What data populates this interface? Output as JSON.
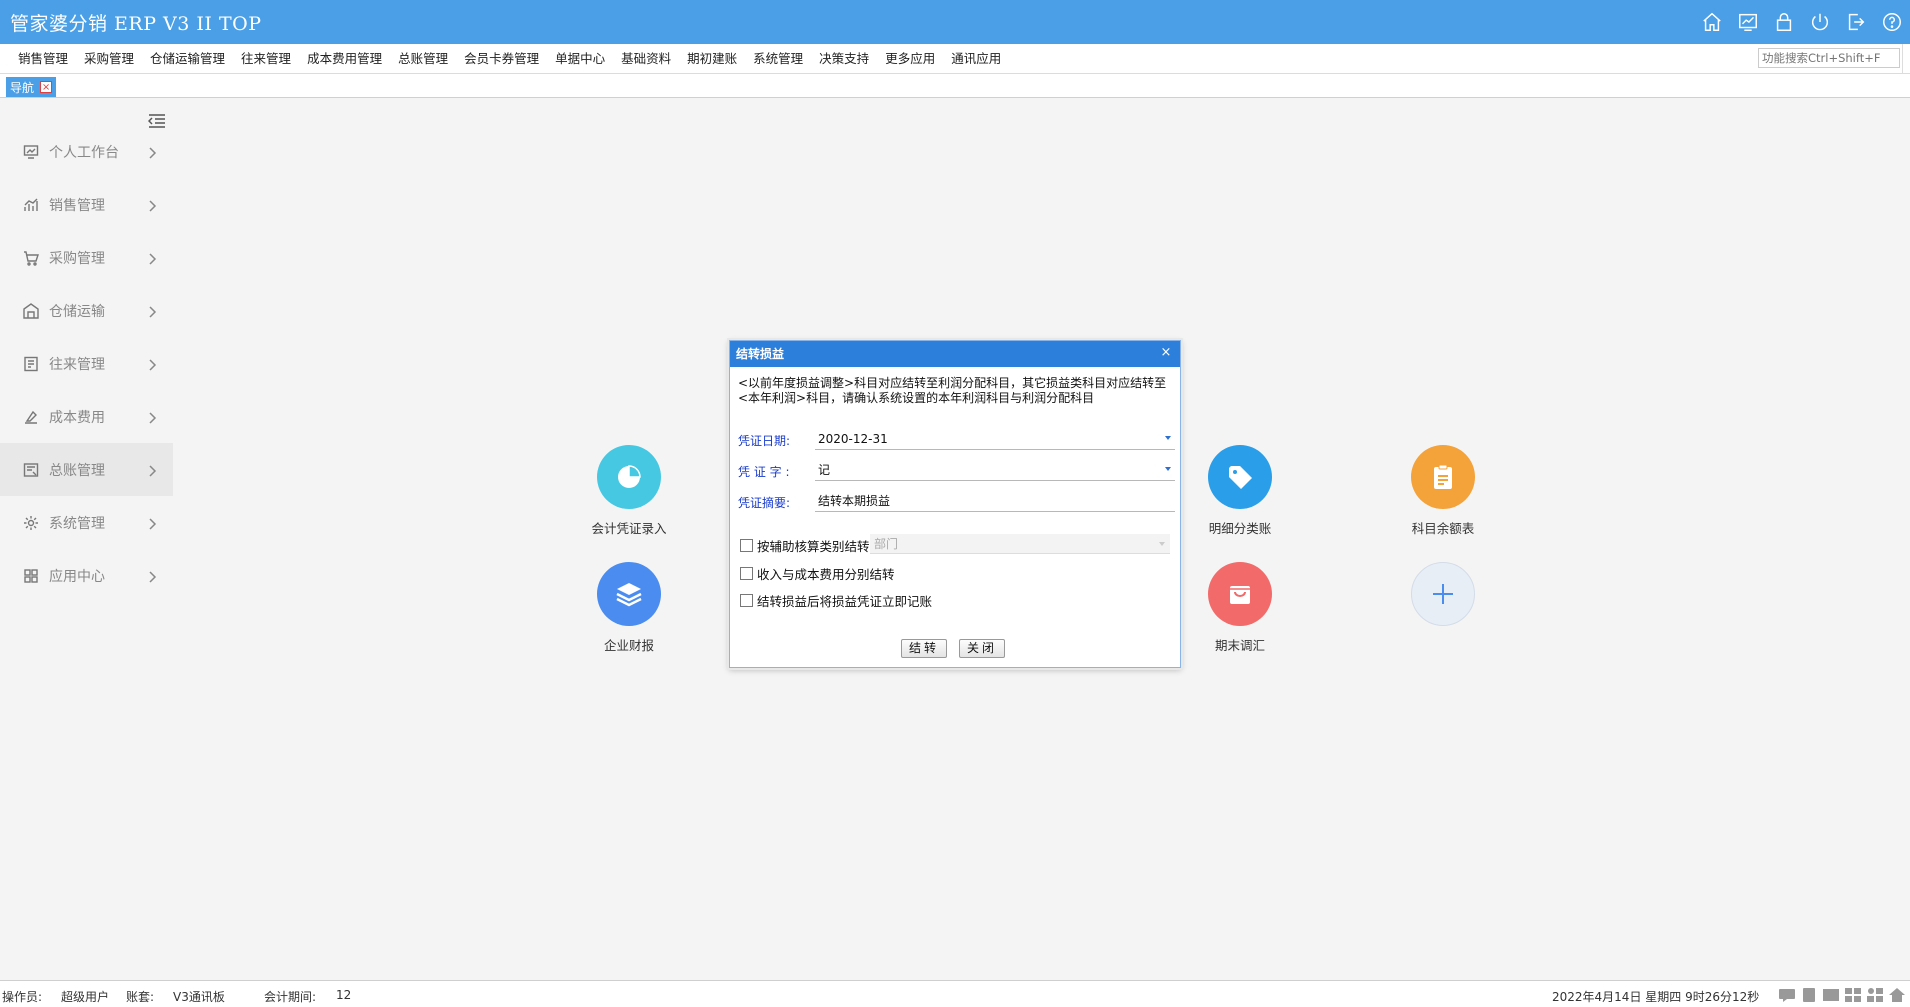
{
  "app": {
    "title": "管家婆分销 ERP V3 II TOP"
  },
  "menu": {
    "items": [
      "销售管理",
      "采购管理",
      "仓储运输管理",
      "往来管理",
      "成本费用管理",
      "总账管理",
      "会员卡券管理",
      "单据中心",
      "基础资料",
      "期初建账",
      "系统管理",
      "决策支持",
      "更多应用",
      "通讯应用"
    ],
    "search_placeholder": "功能搜索Ctrl+Shift+F"
  },
  "tabs": [
    {
      "label": "导航"
    }
  ],
  "sidebar": {
    "items": [
      {
        "label": "个人工作台",
        "icon": "monitor-icon"
      },
      {
        "label": "销售管理",
        "icon": "chart-icon"
      },
      {
        "label": "采购管理",
        "icon": "cart-icon"
      },
      {
        "label": "仓储运输",
        "icon": "warehouse-icon"
      },
      {
        "label": "往来管理",
        "icon": "document-icon"
      },
      {
        "label": "成本费用",
        "icon": "cost-icon"
      },
      {
        "label": "总账管理",
        "icon": "ledger-icon",
        "active": true
      },
      {
        "label": "系统管理",
        "icon": "gear-icon"
      },
      {
        "label": "应用中心",
        "icon": "apps-icon"
      }
    ]
  },
  "shortcuts": [
    {
      "label": "会计凭证录入",
      "icon": "pie-icon",
      "color": "#46c8e2"
    },
    {
      "label": "企业财报",
      "icon": "layers-icon",
      "color": "#4a8cf0"
    },
    {
      "label": "明细分类账",
      "icon": "tag-icon",
      "color": "#2a9ee8"
    },
    {
      "label": "期末调汇",
      "icon": "bag-icon",
      "color": "#f26a6a"
    },
    {
      "label": "科目余额表",
      "icon": "clipboard-icon",
      "color": "#f4a23a"
    },
    {
      "label": "",
      "icon": "plus-icon",
      "color": "#e8eef6"
    }
  ],
  "dialog": {
    "title": "结转损益",
    "description": "<以前年度损益调整>科目对应结转至利润分配科目，其它损益类科目对应结转至<本年利润>科目，请确认系统设置的本年利润科目与利润分配科目",
    "date_label": "凭证日期:",
    "date_value": "2020-12-31",
    "voucher_word_label": "凭 证 字 :",
    "voucher_word_value": "记",
    "summary_label": "凭证摘要:",
    "summary_value": "结转本期损益",
    "checkbox_aux": "按辅助核算类别结转",
    "dept_placeholder": "部门",
    "checkbox_income_cost": "收入与成本费用分别结转",
    "checkbox_post": "结转损益后将损益凭证立即记账",
    "btn_confirm": "结转",
    "btn_close": "关闭"
  },
  "status": {
    "operator_label": "操作员:",
    "operator_value": "超级用户",
    "account_label": "账套:",
    "account_value": "V3通讯板",
    "period_label": "会计期间:",
    "period_value": "12",
    "datetime": "2022年4月14日  星期四  9时26分12秒"
  }
}
